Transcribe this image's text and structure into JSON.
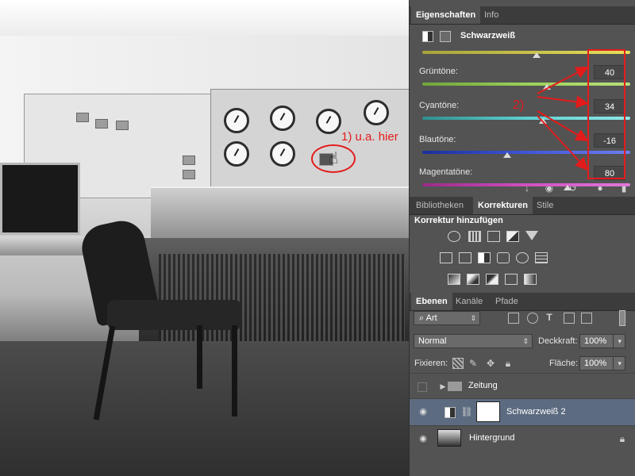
{
  "photo": {
    "annotation_1": "1) u.a. hier",
    "annotation_2": "2)"
  },
  "panel_tabs": [
    "Eigenschaften",
    "Info"
  ],
  "properties": {
    "adjustment_title": "Schwarzweiß",
    "sliders": [
      {
        "label": "Grüntöne:",
        "value": "40",
        "level": 0.6,
        "gradient": [
          "#6fa53a",
          "#9bd05a",
          "#b9e07a"
        ]
      },
      {
        "label": "Cyantöne:",
        "value": "34",
        "level": 0.58,
        "gradient": [
          "#2f8f8f",
          "#5fd0d0",
          "#8fe8e8"
        ]
      },
      {
        "label": "Blautöne:",
        "value": "-16",
        "level": 0.41,
        "gradient": [
          "#1a2f9a",
          "#4056d8",
          "#6e7ef0"
        ]
      },
      {
        "label": "Magentatöne:",
        "value": "80",
        "level": 0.7,
        "gradient": [
          "#9a2a8a",
          "#d050c0",
          "#e078d8"
        ]
      }
    ]
  },
  "corrections_tabs": [
    "Bibliotheken",
    "Korrekturen",
    "Stile"
  ],
  "corrections": {
    "title": "Korrektur hinzufügen"
  },
  "layers_tabs": [
    "Ebenen",
    "Kanäle",
    "Pfade"
  ],
  "layers": {
    "filter": "Art",
    "blend_mode": "Normal",
    "opacity_label": "Deckkraft:",
    "opacity_value": "100%",
    "lock_label": "Fixieren:",
    "fill_label": "Fläche:",
    "fill_value": "100%",
    "items": [
      {
        "name": "Zeitung",
        "type": "group",
        "visible": false
      },
      {
        "name": "Schwarzweiß 2",
        "type": "adjustment",
        "visible": true,
        "selected": true
      },
      {
        "name": "Hintergrund",
        "type": "image",
        "visible": true,
        "locked": true
      }
    ]
  },
  "icons": {
    "eye": "eye-icon",
    "lock": "lock-icon",
    "folder": "folder-icon",
    "hand_cursor": "hand-cursor-icon"
  },
  "colors": {
    "annotation_red": "#e41b1b",
    "panel_bg": "#535353",
    "selected_layer": "#5c6b80"
  }
}
